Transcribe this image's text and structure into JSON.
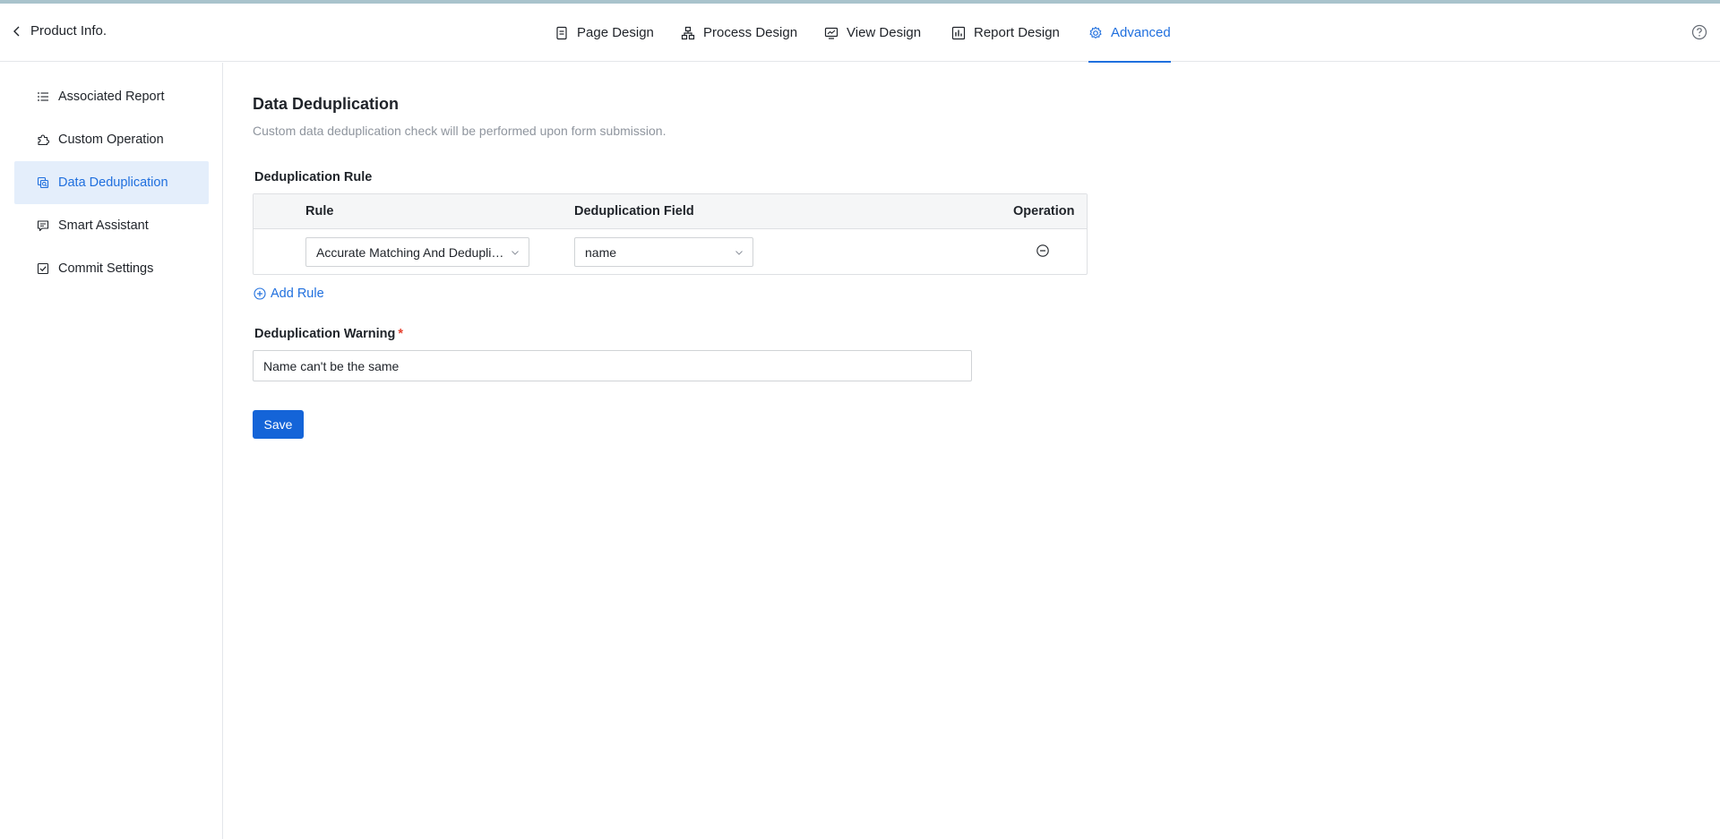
{
  "header": {
    "back_label": "Product Info.",
    "tabs": [
      {
        "label": "Page Design",
        "icon": "document-icon"
      },
      {
        "label": "Process Design",
        "icon": "flow-icon"
      },
      {
        "label": "View Design",
        "icon": "monitor-icon"
      },
      {
        "label": "Report Design",
        "icon": "bar-chart-icon"
      },
      {
        "label": "Advanced",
        "icon": "gear-icon",
        "active": true
      }
    ],
    "help_icon": "help-circle-icon"
  },
  "sidebar": {
    "items": [
      {
        "label": "Associated Report",
        "icon": "list-icon"
      },
      {
        "label": "Custom Operation",
        "icon": "puzzle-icon"
      },
      {
        "label": "Data Deduplication",
        "icon": "duplicate-icon",
        "active": true
      },
      {
        "label": "Smart Assistant",
        "icon": "chat-icon"
      },
      {
        "label": "Commit Settings",
        "icon": "checkbox-icon"
      }
    ]
  },
  "main": {
    "title": "Data Deduplication",
    "description": "Custom data deduplication check will be performed upon form submission.",
    "rule_section_label": "Deduplication Rule",
    "table": {
      "headers": {
        "rule": "Rule",
        "field": "Deduplication Field",
        "operation": "Operation"
      },
      "rows": [
        {
          "rule": "Accurate Matching And Deduplication",
          "field": "name"
        }
      ]
    },
    "add_rule_label": "Add Rule",
    "warning_label": "Deduplication Warning",
    "required_mark": "*",
    "warning_value": "Name can't be the same",
    "save_label": "Save"
  },
  "colors": {
    "accent": "#1f6fde",
    "button": "#1464d8",
    "active_bg": "#e4eefb",
    "required": "#e5412f"
  }
}
